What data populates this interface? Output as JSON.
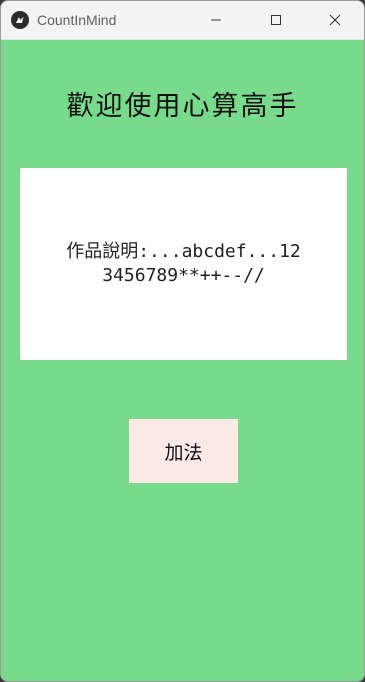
{
  "window": {
    "title": "CountInMind",
    "icon": "kivy-logo-icon",
    "controls": [
      "minimize-icon",
      "maximize-icon",
      "close-icon"
    ]
  },
  "main": {
    "heading": "歡迎使用心算高手",
    "description": "作品說明:...abcdef...123456789**++--//",
    "add_button_label": "加法"
  },
  "colors": {
    "background": "#78db8c",
    "description_box": "#ffffff",
    "button": "#fbe9e5"
  }
}
